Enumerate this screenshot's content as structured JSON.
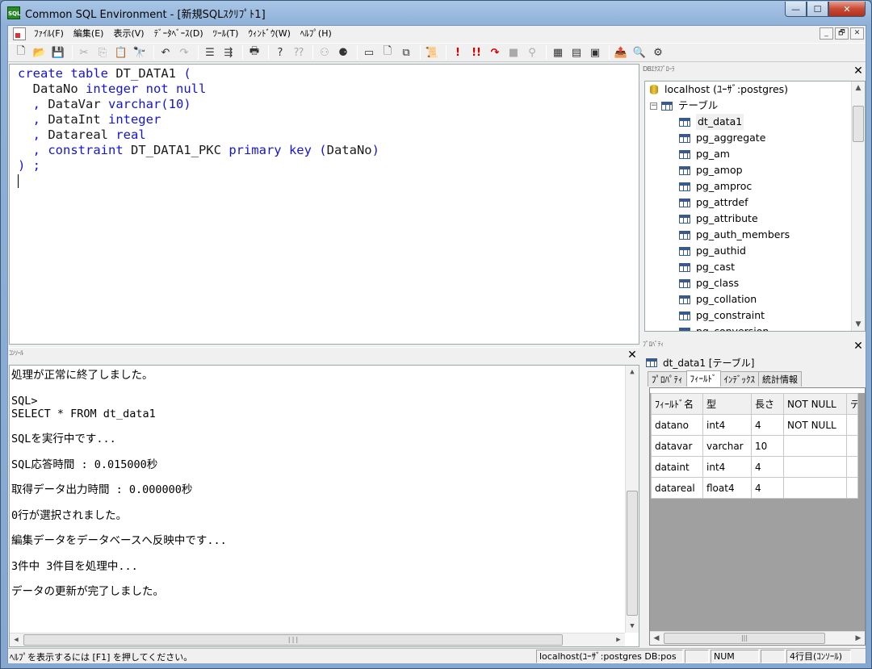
{
  "window": {
    "title": "Common SQL Environment - [新規SQLｽｸﾘﾌﾟﾄ1]",
    "app_icon_text": "SQL",
    "caption": {
      "minimize": "—",
      "maximize": "☐",
      "close": "✕"
    }
  },
  "menu": {
    "items": [
      "ﾌｧｲﾙ(F)",
      "編集(E)",
      "表示(V)",
      "ﾃﾞｰﾀﾍﾞｰｽ(D)",
      "ﾂｰﾙ(T)",
      "ｳｨﾝﾄﾞｳ(W)",
      "ﾍﾙﾌﾟ(H)"
    ],
    "mdi": {
      "minimize": "_",
      "restore": "🗗",
      "close": "✕"
    }
  },
  "toolbar": {
    "icons": [
      {
        "name": "new-file-icon",
        "glyph": "🗋"
      },
      {
        "name": "open-folder-icon",
        "glyph": "📂"
      },
      {
        "name": "save-icon",
        "glyph": "💾"
      },
      {
        "sep": true
      },
      {
        "name": "cut-icon",
        "glyph": "✂",
        "muted": true
      },
      {
        "name": "copy-icon",
        "glyph": "⎘",
        "muted": true
      },
      {
        "name": "paste-icon",
        "glyph": "📋"
      },
      {
        "name": "find-icon",
        "glyph": "🔭"
      },
      {
        "sep": true
      },
      {
        "name": "undo-icon",
        "glyph": "↶"
      },
      {
        "name": "redo-icon",
        "glyph": "↷",
        "muted": true
      },
      {
        "sep": true
      },
      {
        "name": "indent-icon",
        "glyph": "☰"
      },
      {
        "name": "outdent-icon",
        "glyph": "⇶"
      },
      {
        "sep": true
      },
      {
        "name": "print-icon",
        "glyph": "🖶"
      },
      {
        "sep": true
      },
      {
        "name": "help-icon",
        "glyph": "?"
      },
      {
        "name": "context-help-icon",
        "glyph": "⁇",
        "muted": true
      },
      {
        "sep": true
      },
      {
        "name": "connect-icon",
        "glyph": "⚇",
        "muted": true
      },
      {
        "name": "disconnect-icon",
        "glyph": "⚈"
      },
      {
        "sep": true
      },
      {
        "name": "window-icon",
        "glyph": "▭"
      },
      {
        "name": "document-icon",
        "glyph": "🗋"
      },
      {
        "name": "cascade-icon",
        "glyph": "⧉"
      },
      {
        "sep": true
      },
      {
        "name": "script-icon",
        "glyph": "📜"
      },
      {
        "sep": true
      },
      {
        "name": "execute-icon",
        "glyph": "!",
        "red": true
      },
      {
        "name": "execute-all-icon",
        "glyph": "!!",
        "red": true
      },
      {
        "name": "step-icon",
        "glyph": "↷",
        "red": true
      },
      {
        "name": "stop-icon",
        "glyph": "■",
        "muted": true
      },
      {
        "name": "explain-icon",
        "glyph": "⚲",
        "muted": true
      },
      {
        "sep": true
      },
      {
        "name": "table-add-icon",
        "glyph": "▦"
      },
      {
        "name": "table-edit-icon",
        "glyph": "▤"
      },
      {
        "name": "table-view-icon",
        "glyph": "▣"
      },
      {
        "sep": true
      },
      {
        "name": "export-icon",
        "glyph": "📤"
      },
      {
        "name": "search-icon",
        "glyph": "🔍"
      },
      {
        "name": "properties-icon",
        "glyph": "⚙"
      }
    ]
  },
  "editor": {
    "lines": [
      [
        {
          "t": "create table ",
          "k": "kw"
        },
        {
          "t": "DT_DATA1",
          "k": "id"
        },
        {
          "t": " (",
          "k": "kw"
        }
      ],
      [
        {
          "t": "  DataNo ",
          "k": "id"
        },
        {
          "t": "integer not null",
          "k": "kw"
        }
      ],
      [
        {
          "t": "  , ",
          "k": "kw"
        },
        {
          "t": "DataVar ",
          "k": "id"
        },
        {
          "t": "varchar(10)",
          "k": "kw"
        }
      ],
      [
        {
          "t": "  , ",
          "k": "kw"
        },
        {
          "t": "DataInt ",
          "k": "id"
        },
        {
          "t": "integer",
          "k": "kw"
        }
      ],
      [
        {
          "t": "  , ",
          "k": "kw"
        },
        {
          "t": "Datareal ",
          "k": "id"
        },
        {
          "t": "real",
          "k": "kw"
        }
      ],
      [
        {
          "t": "  , ",
          "k": "kw"
        },
        {
          "t": "constraint ",
          "k": "kw"
        },
        {
          "t": "DT_DATA1_PKC ",
          "k": "id"
        },
        {
          "t": "primary key (",
          "k": "kw"
        },
        {
          "t": "DataNo",
          "k": "id"
        },
        {
          "t": ")",
          "k": "kw"
        }
      ],
      [
        {
          "t": ") ;",
          "k": "kw"
        }
      ]
    ]
  },
  "console": {
    "caption": "ｺﾝｿｰﾙ",
    "lines": [
      {
        "text": "処理が正常に終了しました。",
        "gap": false
      },
      {
        "text": "SQL>",
        "gap": true
      },
      {
        "text": "SELECT * FROM dt_data1",
        "gap": false
      },
      {
        "text": "SQLを実行中です...",
        "gap": true
      },
      {
        "text": "SQL応答時間 : 0.015000秒",
        "gap": true
      },
      {
        "text": "取得データ出力時間 : 0.000000秒",
        "gap": true
      },
      {
        "text": "0行が選択されました。",
        "gap": true
      },
      {
        "text": "編集データをデータベースへ反映中です...",
        "gap": true
      },
      {
        "text": "3件中 3件目を処理中...",
        "gap": true
      },
      {
        "text": "データの更新が完了しました。",
        "gap": true
      }
    ]
  },
  "db_explorer": {
    "caption": "DBｴｸｽﾌﾟﾛｰﾗ",
    "connection": "localhost (ﾕｰｻﾞ:postgres)",
    "folder": "テーブル",
    "tables": [
      "dt_data1",
      "pg_aggregate",
      "pg_am",
      "pg_amop",
      "pg_amproc",
      "pg_attrdef",
      "pg_attribute",
      "pg_auth_members",
      "pg_authid",
      "pg_cast",
      "pg_class",
      "pg_collation",
      "pg_constraint",
      "pg_conversion"
    ],
    "selected": "dt_data1"
  },
  "properties": {
    "caption": "ﾌﾟﾛﾊﾟﾃｨ",
    "object_title": "dt_data1 [テーブル]",
    "tabs": [
      "ﾌﾟﾛﾊﾟﾃｨ",
      "ﾌｨｰﾙﾄﾞ",
      "ｲﾝﾃﾞｯｸｽ",
      "統計情報"
    ],
    "active_tab": "ﾌｨｰﾙﾄﾞ",
    "columns": [
      "ﾌｨｰﾙﾄﾞ名",
      "型",
      "長さ",
      "NOT NULL",
      "デ"
    ],
    "rows": [
      [
        "datano",
        "int4",
        "4",
        "NOT NULL",
        ""
      ],
      [
        "datavar",
        "varchar",
        "10",
        "",
        ""
      ],
      [
        "dataint",
        "int4",
        "4",
        "",
        ""
      ],
      [
        "datareal",
        "float4",
        "4",
        "",
        ""
      ]
    ]
  },
  "statusbar": {
    "help": "ﾍﾙﾌﾟを表示するには [F1] を押してください。",
    "connection": "localhost(ﾕｰｻﾞ:postgres DB:pos",
    "num": "NUM",
    "position": "4行目(ｺﾝｿｰﾙ)"
  }
}
